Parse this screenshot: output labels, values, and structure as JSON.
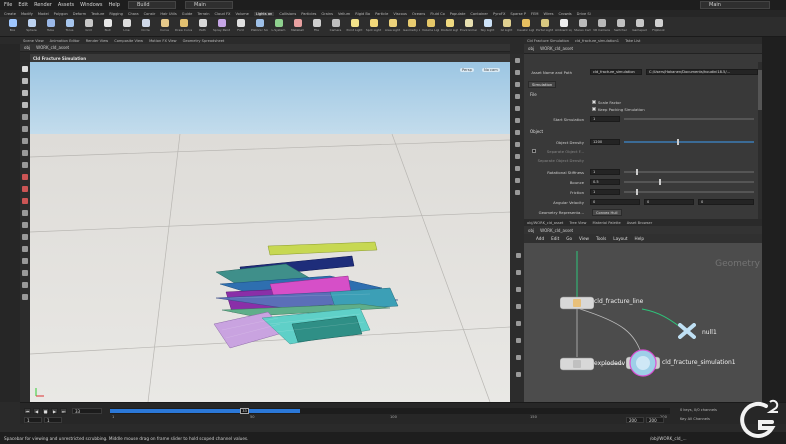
{
  "menubar": {
    "items": [
      "File",
      "Edit",
      "Render",
      "Assets",
      "Windows",
      "Help"
    ],
    "desktop_build": "Build",
    "desktop_main": "Main",
    "desktop_right": "Main"
  },
  "shelf_tabs": [
    "Create",
    "Modify",
    "Model",
    "Polygon",
    "Deform",
    "Texture",
    "Rigging",
    "Chara",
    "Constr",
    "Hair Utils",
    "Guide",
    "Terrain",
    "Cloud FX",
    "Volume",
    "Lights an",
    "Collisions",
    "Particles",
    "Grains",
    "Vellum",
    "Rigid Bo",
    "Particle",
    "Viscous",
    "Oceans",
    "Fluid Co",
    "Populate",
    "Container",
    "PyroFX",
    "Sparse P",
    "FEM",
    "Wires",
    "Crowds",
    "Drive Si"
  ],
  "tools": [
    {
      "label": "Box",
      "color": "#9fc7ff"
    },
    {
      "label": "Sphere",
      "color": "#bcd2f0"
    },
    {
      "label": "Tube",
      "color": "#9ab8e8"
    },
    {
      "label": "Torus",
      "color": "#a7c6ee"
    },
    {
      "label": "Grid",
      "color": "#c9c9c9"
    },
    {
      "label": "Null",
      "color": "#e8e8e8"
    },
    {
      "label": "Line",
      "color": "#dddddd"
    },
    {
      "label": "Circle",
      "color": "#cfd8e8"
    },
    {
      "label": "Curve",
      "color": "#e6c98a"
    },
    {
      "label": "Draw Curve",
      "color": "#e2c070"
    },
    {
      "label": "Path",
      "color": "#d8d8d8"
    },
    {
      "label": "Spray Paint",
      "color": "#c6a6e6"
    },
    {
      "label": "Font",
      "color": "#e0e0e0"
    },
    {
      "label": "Platonic Solids",
      "color": "#9ec0e8"
    },
    {
      "label": "L-System",
      "color": "#8fd18f"
    },
    {
      "label": "Metaball",
      "color": "#e8a0a0"
    },
    {
      "label": "File",
      "color": "#d0d0d0"
    },
    {
      "label": "Camera",
      "color": "#bfbfbf"
    },
    {
      "label": "Point Light",
      "color": "#f2e28a"
    },
    {
      "label": "Spot Light",
      "color": "#f2d87a"
    },
    {
      "label": "Area Light",
      "color": "#ecd27a"
    },
    {
      "label": "Geometry Light",
      "color": "#e8cc70"
    },
    {
      "label": "Volume Light",
      "color": "#e6c868"
    },
    {
      "label": "Distant Light",
      "color": "#f0da80"
    },
    {
      "label": "Environment Light",
      "color": "#e8e0b0"
    },
    {
      "label": "Sky Light",
      "color": "#cde2f8"
    },
    {
      "label": "GI Light",
      "color": "#e0d090"
    },
    {
      "label": "Caustic Light",
      "color": "#e8c060"
    },
    {
      "label": "Portal Light",
      "color": "#d8c880"
    },
    {
      "label": "Ambient Light",
      "color": "#eeeeee"
    },
    {
      "label": "Stereo Camera",
      "color": "#bcbcbc"
    },
    {
      "label": "VR Camera",
      "color": "#b8b8b8"
    },
    {
      "label": "Switcher",
      "color": "#c0c0c0"
    },
    {
      "label": "Gamepad",
      "color": "#c8c8c8"
    },
    {
      "label": "Flipbook",
      "color": "#d0d0d0"
    }
  ],
  "left_pane_tabs": [
    "Scene View",
    "Animation Editor",
    "Render View",
    "Composite View",
    "Motion FX View",
    "Geometry Spreadsheet"
  ],
  "right_pane_tabs": [
    "Cld Fracture Simulation",
    "cld_fracture_simulation1",
    "Take List"
  ],
  "viewport": {
    "path": [
      "obj",
      "WORK_cld_asset"
    ],
    "header": "Cld Fracture Simulation",
    "persp_tag": "Persp",
    "cam_tag": "No cam"
  },
  "params": {
    "asset_label": "Asset Name and Path",
    "asset_name": "cld_fracture_simulation",
    "asset_path": "C:/Users/Hakanen/Documents/houdini18.5/...",
    "tab": "Simulation",
    "section_file": "File",
    "scale_factor_label": "Scale Factor",
    "keep_packing_label": "Keep Packing Simulation",
    "start_simulation_label": "Start Simulation",
    "start_simulation_value": "1",
    "section_object": "Object",
    "object_density_label": "Object Density",
    "object_density_value": "1200",
    "separate_object_label": "Separate Object F...",
    "separate_density_label": "Separate Object Density",
    "rotational_stiffness_label": "Rotational Stiffness",
    "rotational_stiffness_value": "1",
    "bounce_label": "Bounce",
    "bounce_value": "0.5",
    "friction_label": "Friction",
    "friction_value": "1",
    "angular_velocity_label": "Angular Velocity",
    "angular_velocity_values": [
      "0",
      "0",
      "0"
    ],
    "geometry_representation_label": "Geometry Representa...",
    "geometry_representation_value": "Convex Hull"
  },
  "network": {
    "tabs": [
      "obj/WORK_cld_asset",
      "Tree View",
      "Material Palette",
      "Asset Browser"
    ],
    "path": [
      "obj",
      "WORK_cld_asset"
    ],
    "menu": [
      "Add",
      "Edit",
      "Go",
      "View",
      "Tools",
      "Layout",
      "Help"
    ],
    "context_label": "Geometry",
    "nodes": {
      "fracture_line": "cld_fracture_line",
      "null": "null1",
      "exploded": "explodedv",
      "simulation": "cld_fracture_simulation1"
    }
  },
  "timeline": {
    "current_frame": "33",
    "start_frame": "1",
    "start_frame2": "1",
    "end_frame": "200",
    "end_frame2": "200",
    "cursor_label": "33",
    "ticks": [
      "1",
      "50",
      "100",
      "150",
      "200"
    ],
    "keys_label": "0 keys, 0/0 channels",
    "key_all": "Key All Channels"
  },
  "cache_fraction": 0.34,
  "status": {
    "text": "Spacebar for viewing and unrestricted scrubbing. Middle mouse drag on frame slider to hold scoped channel values.",
    "right": "/obj/WORK_cld_..."
  },
  "colors": {
    "accent": "#2b78d8",
    "sky": "#a9cfe8",
    "ground": "#e4e2de",
    "network_bg": "#4c4c4c"
  }
}
